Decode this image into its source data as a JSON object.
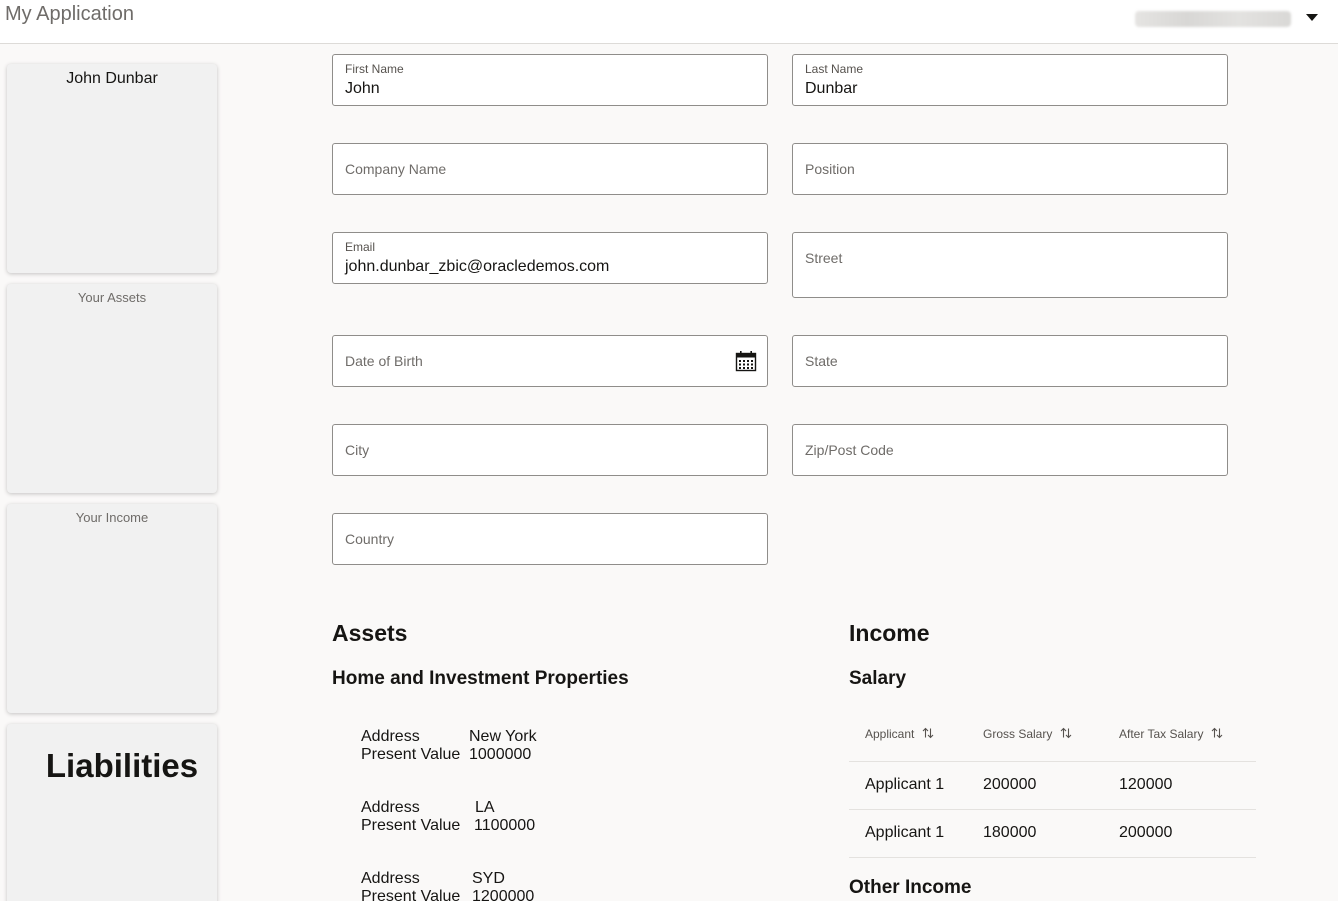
{
  "header": {
    "title": "My Application"
  },
  "sidebar": {
    "cards": [
      {
        "title": "John Dunbar"
      },
      {
        "title": "Your Assets"
      },
      {
        "title": "Your Income"
      },
      {
        "title": "Liabilities"
      }
    ]
  },
  "form": {
    "first_name": {
      "label": "First Name",
      "value": "John"
    },
    "last_name": {
      "label": "Last Name",
      "value": "Dunbar"
    },
    "company_name": {
      "placeholder": "Company Name"
    },
    "position": {
      "placeholder": "Position"
    },
    "email": {
      "label": "Email",
      "value": "john.dunbar_zbic@oracledemos.com"
    },
    "street": {
      "placeholder": "Street"
    },
    "date_of_birth": {
      "placeholder": "Date of Birth"
    },
    "state": {
      "placeholder": "State"
    },
    "city": {
      "placeholder": "City"
    },
    "zip": {
      "placeholder": "Zip/Post Code"
    },
    "country": {
      "placeholder": "Country"
    }
  },
  "assets": {
    "heading": "Assets",
    "subheading": "Home and Investment Properties",
    "address_label": "Address",
    "present_value_label": "Present Value",
    "properties": [
      {
        "address": "New York",
        "present_value": "1000000"
      },
      {
        "address": "LA",
        "present_value": "1100000"
      },
      {
        "address": "SYD",
        "present_value": "1200000"
      }
    ]
  },
  "income": {
    "heading": "Income",
    "subheading": "Salary",
    "columns": [
      "Applicant",
      "Gross Salary",
      "After Tax Salary"
    ],
    "rows": [
      [
        "Applicant 1",
        "200000",
        "120000"
      ],
      [
        "Applicant 1",
        "180000",
        "200000"
      ]
    ],
    "other_heading": "Other Income"
  },
  "icons": {
    "calendar": "calendar-icon",
    "sort": "sort-icon",
    "caret": "chevron-down-icon"
  }
}
